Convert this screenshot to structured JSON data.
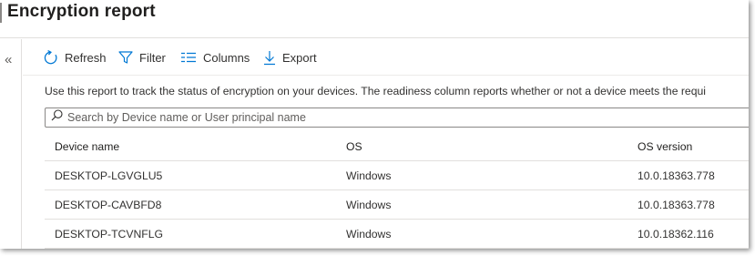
{
  "page": {
    "title": "Encryption report",
    "collapse_glyph": "«"
  },
  "toolbar": {
    "refresh_label": "Refresh",
    "filter_label": "Filter",
    "columns_label": "Columns",
    "export_label": "Export",
    "accent_color": "#0078d4"
  },
  "description": "Use this report to track the status of encryption on your devices. The readiness column reports whether or not a device meets the requi",
  "search": {
    "placeholder": "Search by Device name or User principal name",
    "value": ""
  },
  "table": {
    "columns": [
      "Device name",
      "OS",
      "OS version"
    ],
    "rows": [
      [
        "DESKTOP-LGVGLU5",
        "Windows",
        "10.0.18363.778"
      ],
      [
        "DESKTOP-CAVBFD8",
        "Windows",
        "10.0.18363.778"
      ],
      [
        "DESKTOP-TCVNFLG",
        "Windows",
        "10.0.18362.116"
      ]
    ]
  }
}
